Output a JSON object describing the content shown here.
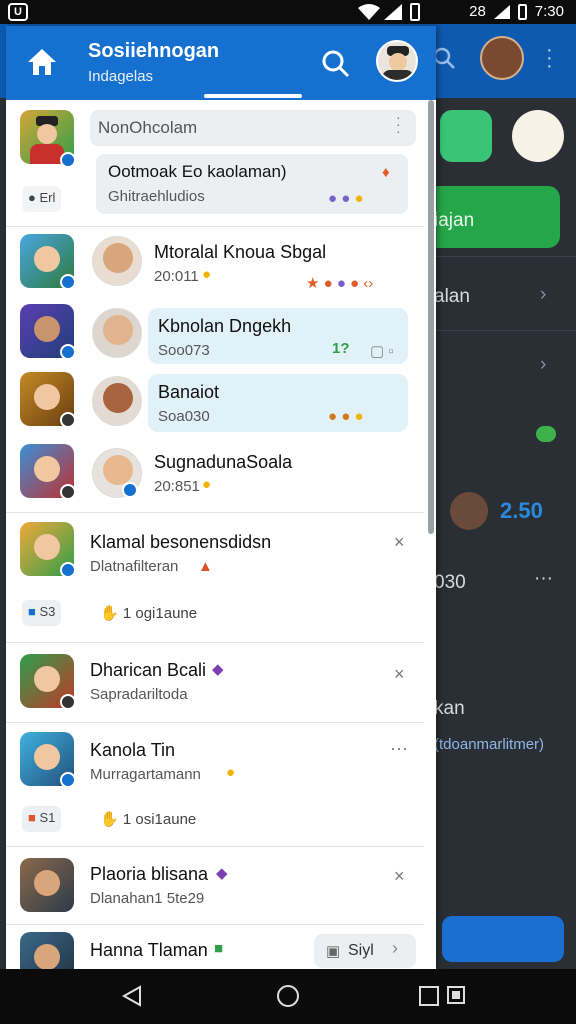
{
  "statusbar": {
    "app_glyph": "U",
    "time": "7:30",
    "left_status": "28"
  },
  "panel": {
    "title": "Sosiiehnogan",
    "subtitle": "Indagelas",
    "pinned": {
      "input_text": "NonOhcolam",
      "bubble_title": "Ootmoak Eo kaolaman)",
      "bubble_sub": "Ghitraehludios",
      "small_label": "Erl"
    },
    "conversations": [
      {
        "name": "Mtoralal Knoua Sbgal",
        "sub": "20:011",
        "bubbled": false
      },
      {
        "name": "Kbnolan Dngekh",
        "sub": "Soo073",
        "bubbled": true,
        "extra": "1?"
      },
      {
        "name": "Banaiot",
        "sub": "Soa030",
        "bubbled": true
      },
      {
        "name": "SugnadunaSoala",
        "sub": "20:851",
        "bubbled": false
      }
    ],
    "posts": [
      {
        "name": "Klamal besonensdidsn",
        "sub": "Dlatnafilteran",
        "pill": "S3",
        "like": "1 ogi1aune",
        "action": "×"
      },
      {
        "name": "Dharican Bcali",
        "sub": "Sapradariltoda",
        "action": "×"
      },
      {
        "name": "Kanola Tin",
        "sub": "Murragartamann",
        "pill": "S1",
        "like": "1 osi1aune",
        "action": "···"
      },
      {
        "name": "Plaoria blisana",
        "sub": "Dlanahan1 5te29",
        "action": "×"
      }
    ],
    "last": {
      "name": "Hanna Tlaman",
      "button": "Siyl"
    }
  },
  "background": {
    "items": [
      "iajan",
      "alan",
      "2.50",
      "030",
      "kan",
      "(tdoanmarlitmer)"
    ]
  },
  "colors": {
    "accent": "#1570d0",
    "bubble": "#e1f1f8",
    "green": "#25a648"
  }
}
